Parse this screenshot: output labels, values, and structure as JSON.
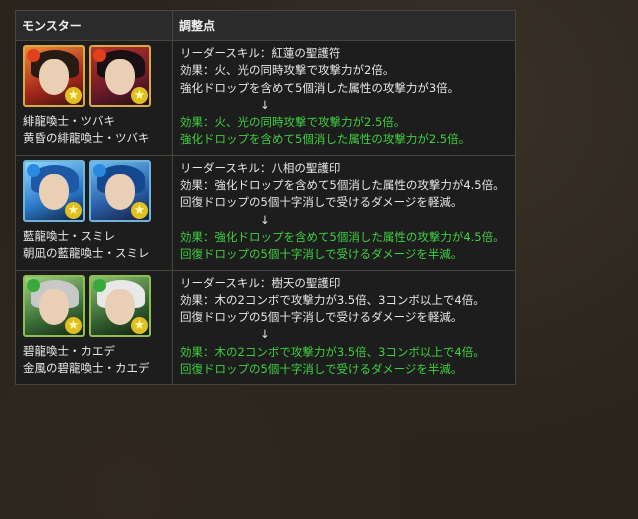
{
  "header": {
    "col1": "モンスター",
    "col2": "調整点"
  },
  "rows": [
    {
      "names": [
        "緋龍喚士・ツバキ",
        "黄昏の緋龍喚士・ツバキ"
      ],
      "before": [
        "リーダースキル：紅蓮の聖護符",
        "効果：火、光の同時攻撃で攻撃力が2倍。",
        "強化ドロップを含めて5個消した属性の攻撃力が3倍。"
      ],
      "arrow": "↓",
      "after": [
        "効果：火、光の同時攻撃で攻撃力が2.5倍。",
        "強化ドロップを含めて5個消した属性の攻撃力が2.5倍。"
      ]
    },
    {
      "names": [
        "藍龍喚士・スミレ",
        "朝凪の藍龍喚士・スミレ"
      ],
      "before": [
        "リーダースキル：八相の聖護印",
        "効果：強化ドロップを含めて5個消した属性の攻撃力が4.5倍。",
        "回復ドロップの5個十字消しで受けるダメージを軽減。"
      ],
      "arrow": "↓",
      "after": [
        "効果：強化ドロップを含めて5個消した属性の攻撃力が4.5倍。",
        "回復ドロップの5個十字消しで受けるダメージを半減。"
      ]
    },
    {
      "names": [
        "碧龍喚士・カエデ",
        "金風の碧龍喚士・カエデ"
      ],
      "before": [
        "リーダースキル：樹天の聖護印",
        "効果：木の2コンボで攻撃力が3.5倍、3コンボ以上で4倍。",
        "回復ドロップの5個十字消しで受けるダメージを軽減。"
      ],
      "arrow": "↓",
      "after": [
        "効果：木の2コンボで攻撃力が3.5倍、3コンボ以上で4倍。",
        "回復ドロップの5個十字消しで受けるダメージを半減。"
      ]
    }
  ],
  "icons": {
    "attribute_glyph": "★",
    "row0": [
      "fire",
      "fire"
    ],
    "row1": [
      "water",
      "water"
    ],
    "row2": [
      "wood",
      "wood"
    ]
  },
  "colors": {
    "changed_text": "#3fd13f",
    "background": "#2a241d",
    "cell": "#1d1d1d"
  }
}
